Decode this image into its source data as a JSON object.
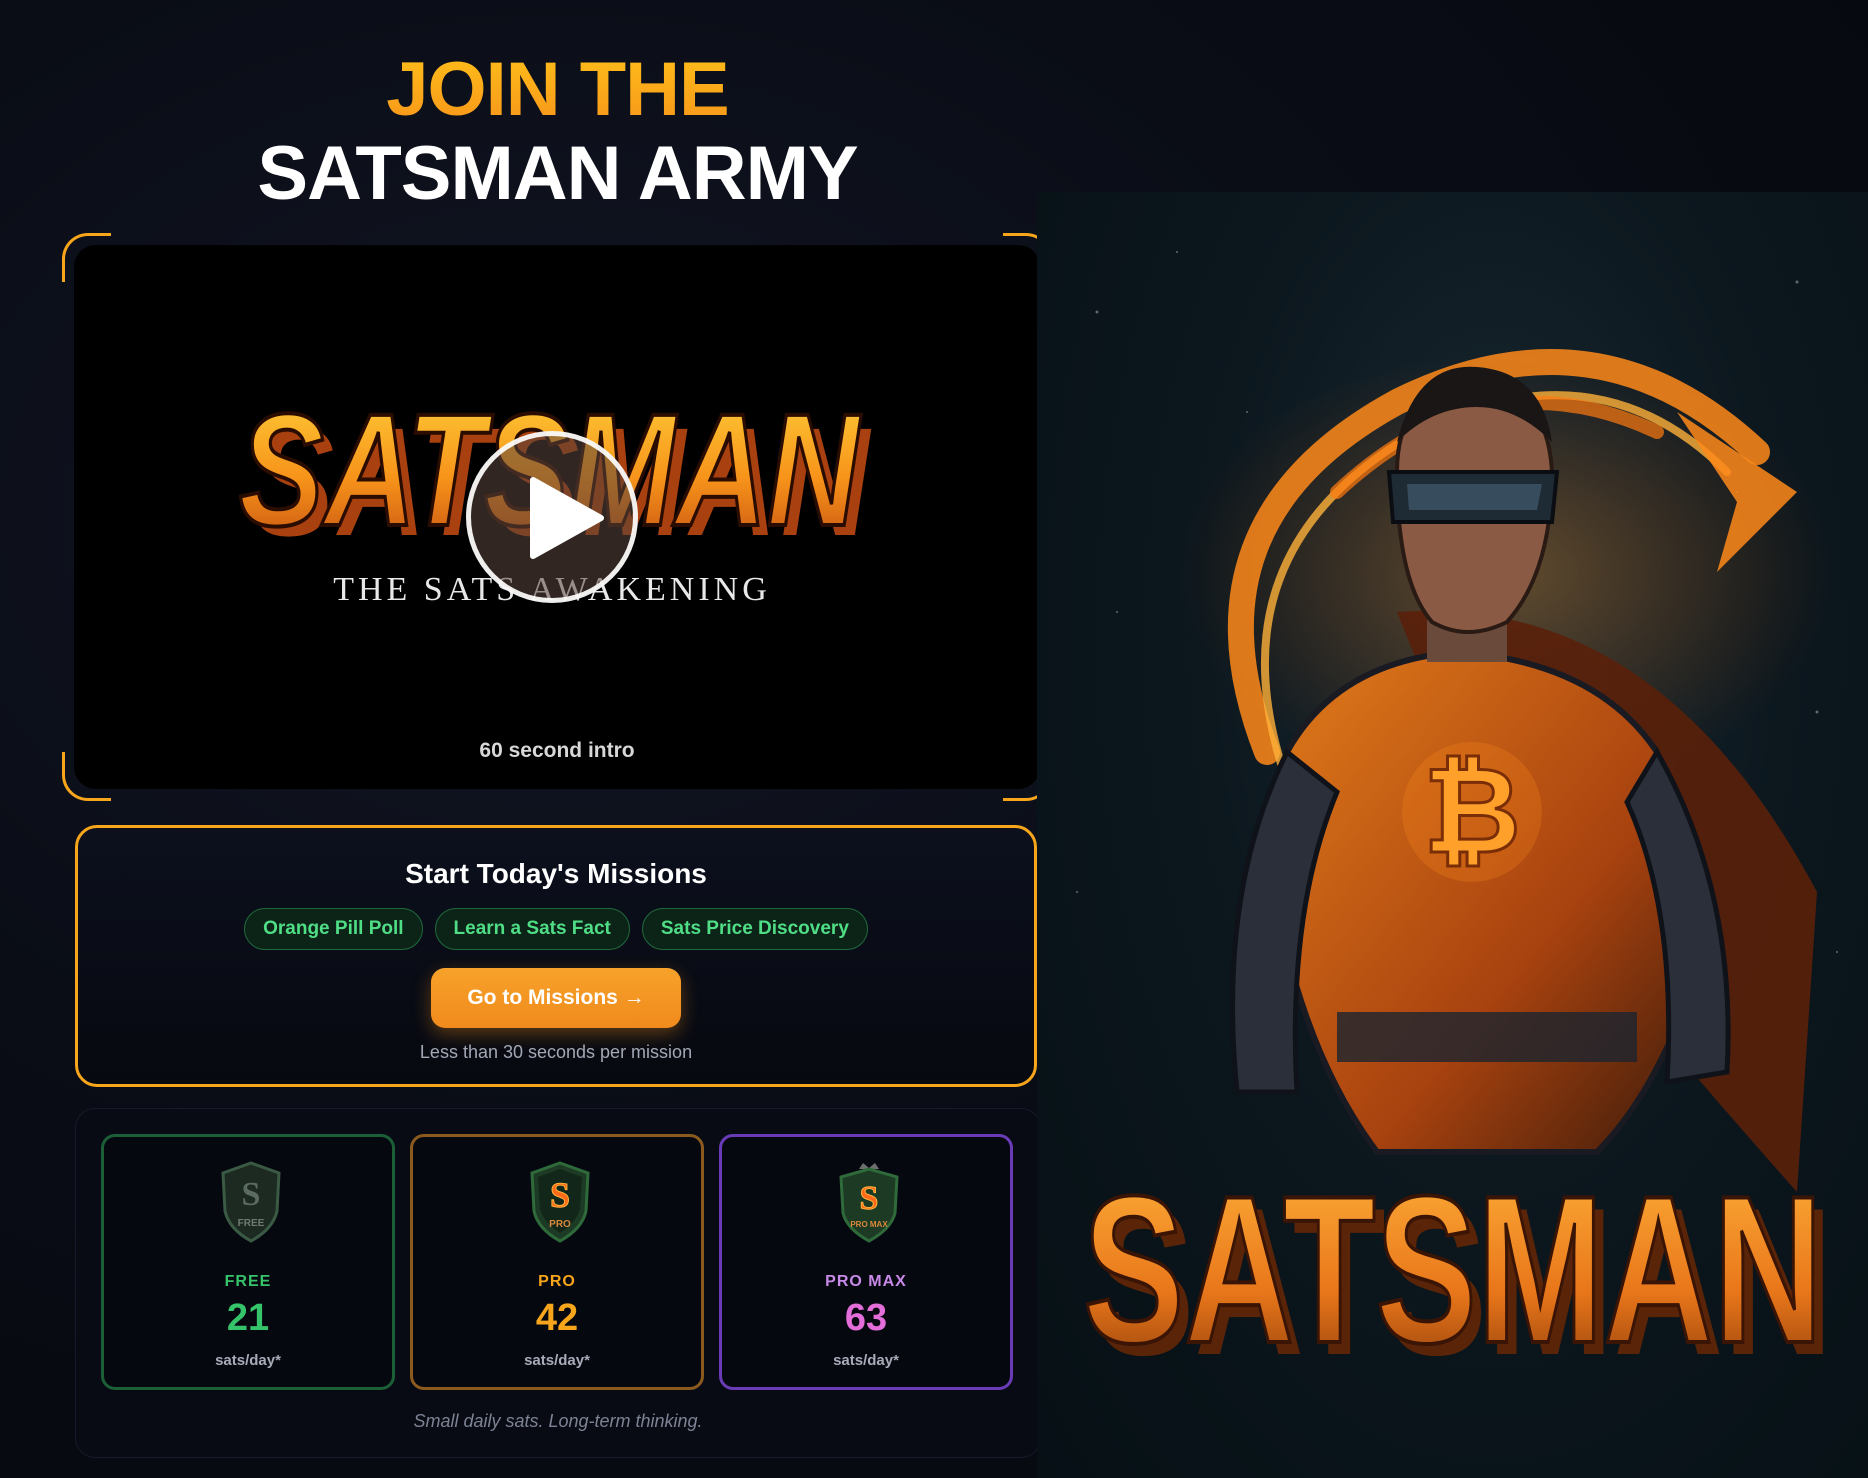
{
  "headline": {
    "line1": "JOIN THE",
    "line2": "SATSMAN ARMY"
  },
  "video": {
    "logo_text": "SATSMAN",
    "logo_subtitle": "THE SATS AWAKENING",
    "caption": "60 second intro"
  },
  "missions": {
    "title": "Start Today's Missions",
    "chips": [
      "Orange Pill Poll",
      "Learn a Sats Fact",
      "Sats Price Discovery"
    ],
    "button_label": "Go to Missions →",
    "subtitle": "Less than 30 seconds per mission"
  },
  "tiers": {
    "items": [
      {
        "name": "FREE",
        "badge": "FREE",
        "value": "21",
        "unit": "sats/day*",
        "color": "#35c46a"
      },
      {
        "name": "PRO",
        "badge": "PRO",
        "value": "42",
        "unit": "sats/day*",
        "color": "#f7a51a"
      },
      {
        "name": "PRO MAX",
        "badge": "PRO MAX",
        "value": "63",
        "unit": "sats/day*",
        "color": "#e36ed9"
      }
    ],
    "footnote": "Small daily sats. Long-term thinking."
  },
  "hero": {
    "title": "SATSMAN",
    "emblem": "bitcoin-b-icon"
  },
  "colors": {
    "accent": "#f7931a",
    "green": "#35c46a",
    "purple": "#e36ed9"
  }
}
